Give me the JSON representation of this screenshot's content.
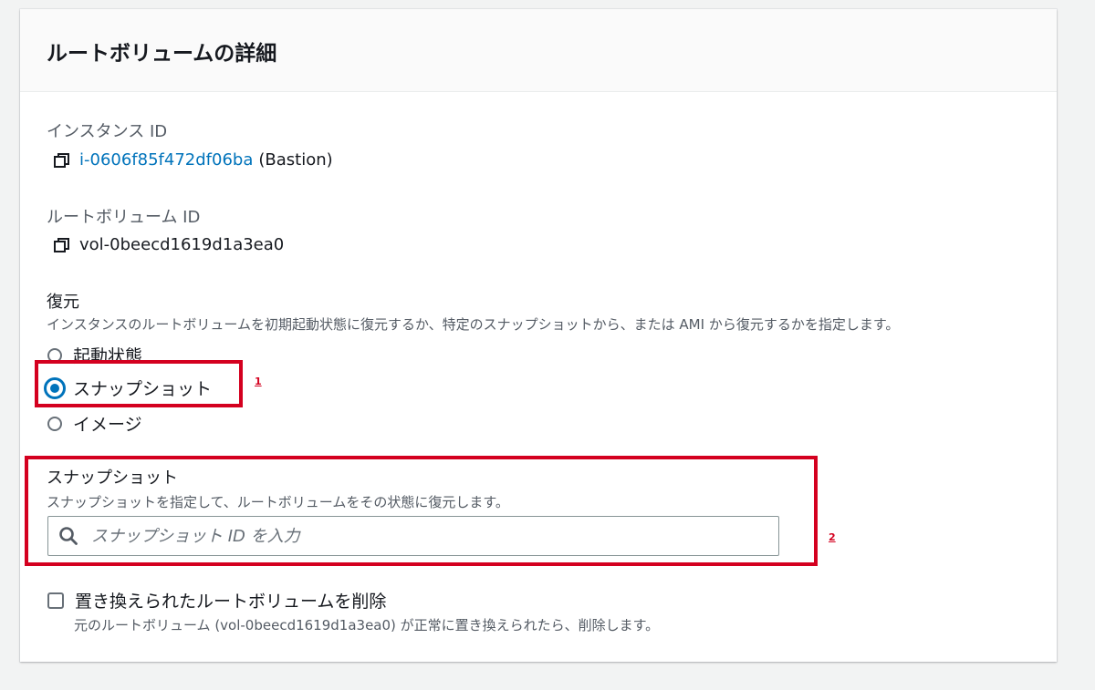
{
  "panel": {
    "title": "ルートボリュームの詳細"
  },
  "instance": {
    "label": "インスタンス ID",
    "id": "i-0606f85f472df06ba",
    "name_suffix": "(Bastion)"
  },
  "root_volume": {
    "label": "ルートボリューム ID",
    "id": "vol-0beecd1619d1a3ea0"
  },
  "restore": {
    "label": "復元",
    "description": "インスタンスのルートボリュームを初期起動状態に復元するか、特定のスナップショットから、または AMI から復元するかを指定します。",
    "options": [
      {
        "label": "起動状態",
        "selected": false
      },
      {
        "label": "スナップショット",
        "selected": true
      },
      {
        "label": "イメージ",
        "selected": false
      }
    ]
  },
  "snapshot": {
    "label": "スナップショット",
    "description": "スナップショットを指定して、ルートボリュームをその状態に復元します。",
    "search_placeholder": "スナップショット ID を入力",
    "search_value": ""
  },
  "delete_option": {
    "label": "置き換えられたルートボリュームを削除",
    "description": "元のルートボリューム (vol-0beecd1619d1a3ea0) が正常に置き換えられたら、削除します。",
    "checked": false
  },
  "annotations": {
    "marker_1": "1",
    "marker_2": "2",
    "highlight_color": "#d4001f"
  },
  "colors": {
    "link": "#0073bb",
    "radio_selected": "#0073bb",
    "background": "#f2f3f3"
  },
  "icons": {
    "copy": "copy-icon",
    "search": "search-icon"
  }
}
